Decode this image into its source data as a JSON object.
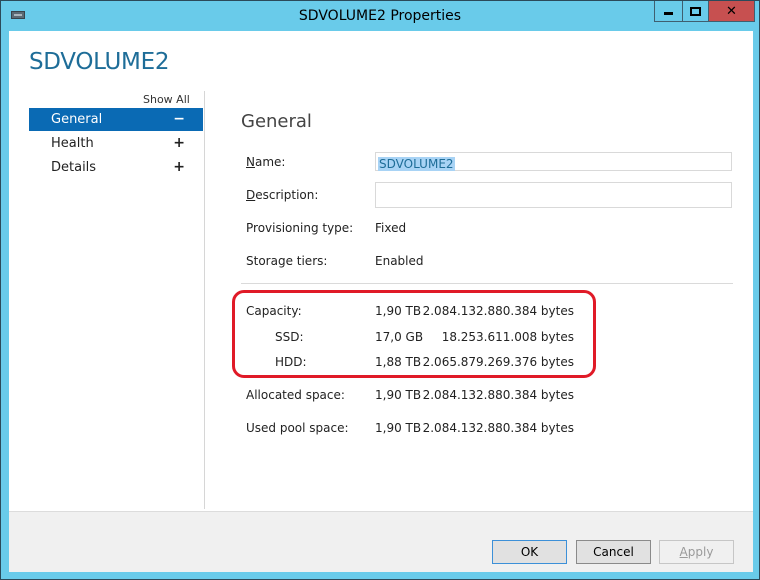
{
  "window": {
    "title": "SDVOLUME2 Properties",
    "icon": "storage-volume-icon",
    "controls": {
      "minimize": "minimize-icon",
      "maximize": "maximize-icon",
      "close": "✕"
    }
  },
  "heading": "SDVOLUME2",
  "nav": {
    "show_all": "Show All",
    "items": [
      {
        "label": "General",
        "sign": "−",
        "active": true
      },
      {
        "label": "Health",
        "sign": "+",
        "active": false
      },
      {
        "label": "Details",
        "sign": "+",
        "active": false
      }
    ]
  },
  "general": {
    "title": "General",
    "name": {
      "label_mnemonic": "N",
      "label_rest": "ame:",
      "value": "SDVOLUME2"
    },
    "description": {
      "label_mnemonic": "D",
      "label_rest": "escription:",
      "value": ""
    },
    "provisioning_type": {
      "label": "Provisioning type:",
      "value": "Fixed"
    },
    "storage_tiers": {
      "label": "Storage tiers:",
      "value": "Enabled"
    },
    "capacity_rows": [
      {
        "label": "Capacity:",
        "size": "1,90 TB",
        "bytes": "2.084.132.880.384 bytes"
      },
      {
        "label": "SSD:",
        "size": "17,0 GB",
        "bytes": "18.253.611.008 bytes"
      },
      {
        "label": "HDD:",
        "size": "1,88 TB",
        "bytes": "2.065.879.269.376 bytes"
      }
    ],
    "allocated_space": {
      "label": "Allocated space:",
      "size": "1,90 TB",
      "bytes": "2.084.132.880.384 bytes"
    },
    "used_pool_space": {
      "label": "Used pool space:",
      "size": "1,90 TB",
      "bytes": "2.084.132.880.384 bytes"
    },
    "highlight_color": "#e01a27"
  },
  "buttons": {
    "ok": "OK",
    "cancel": "Cancel",
    "apply_mnemonic": "A",
    "apply_rest": "pply"
  }
}
